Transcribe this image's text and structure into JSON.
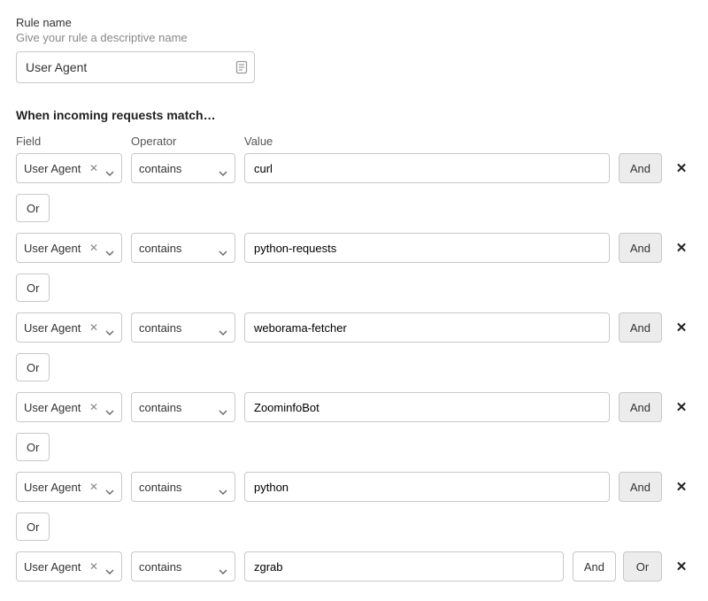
{
  "labels": {
    "rule_name": "Rule name",
    "rule_hint": "Give your rule a descriptive name",
    "section_title": "When incoming requests match…",
    "col_field": "Field",
    "col_operator": "Operator",
    "col_value": "Value",
    "and": "And",
    "or": "Or"
  },
  "rule_name_input": {
    "value": "User Agent"
  },
  "conditions": [
    {
      "field": "User Agent",
      "operator": "contains",
      "value": "curl",
      "actions": [
        "And"
      ],
      "has_or_below": true
    },
    {
      "field": "User Agent",
      "operator": "contains",
      "value": "python-requests",
      "actions": [
        "And"
      ],
      "has_or_below": true
    },
    {
      "field": "User Agent",
      "operator": "contains",
      "value": "weborama-fetcher",
      "actions": [
        "And"
      ],
      "has_or_below": true
    },
    {
      "field": "User Agent",
      "operator": "contains",
      "value": "ZoominfoBot",
      "actions": [
        "And"
      ],
      "has_or_below": true
    },
    {
      "field": "User Agent",
      "operator": "contains",
      "value": "python",
      "actions": [
        "And"
      ],
      "has_or_below": true
    },
    {
      "field": "User Agent",
      "operator": "contains",
      "value": "zgrab",
      "actions": [
        "And",
        "Or"
      ],
      "has_or_below": false
    }
  ]
}
